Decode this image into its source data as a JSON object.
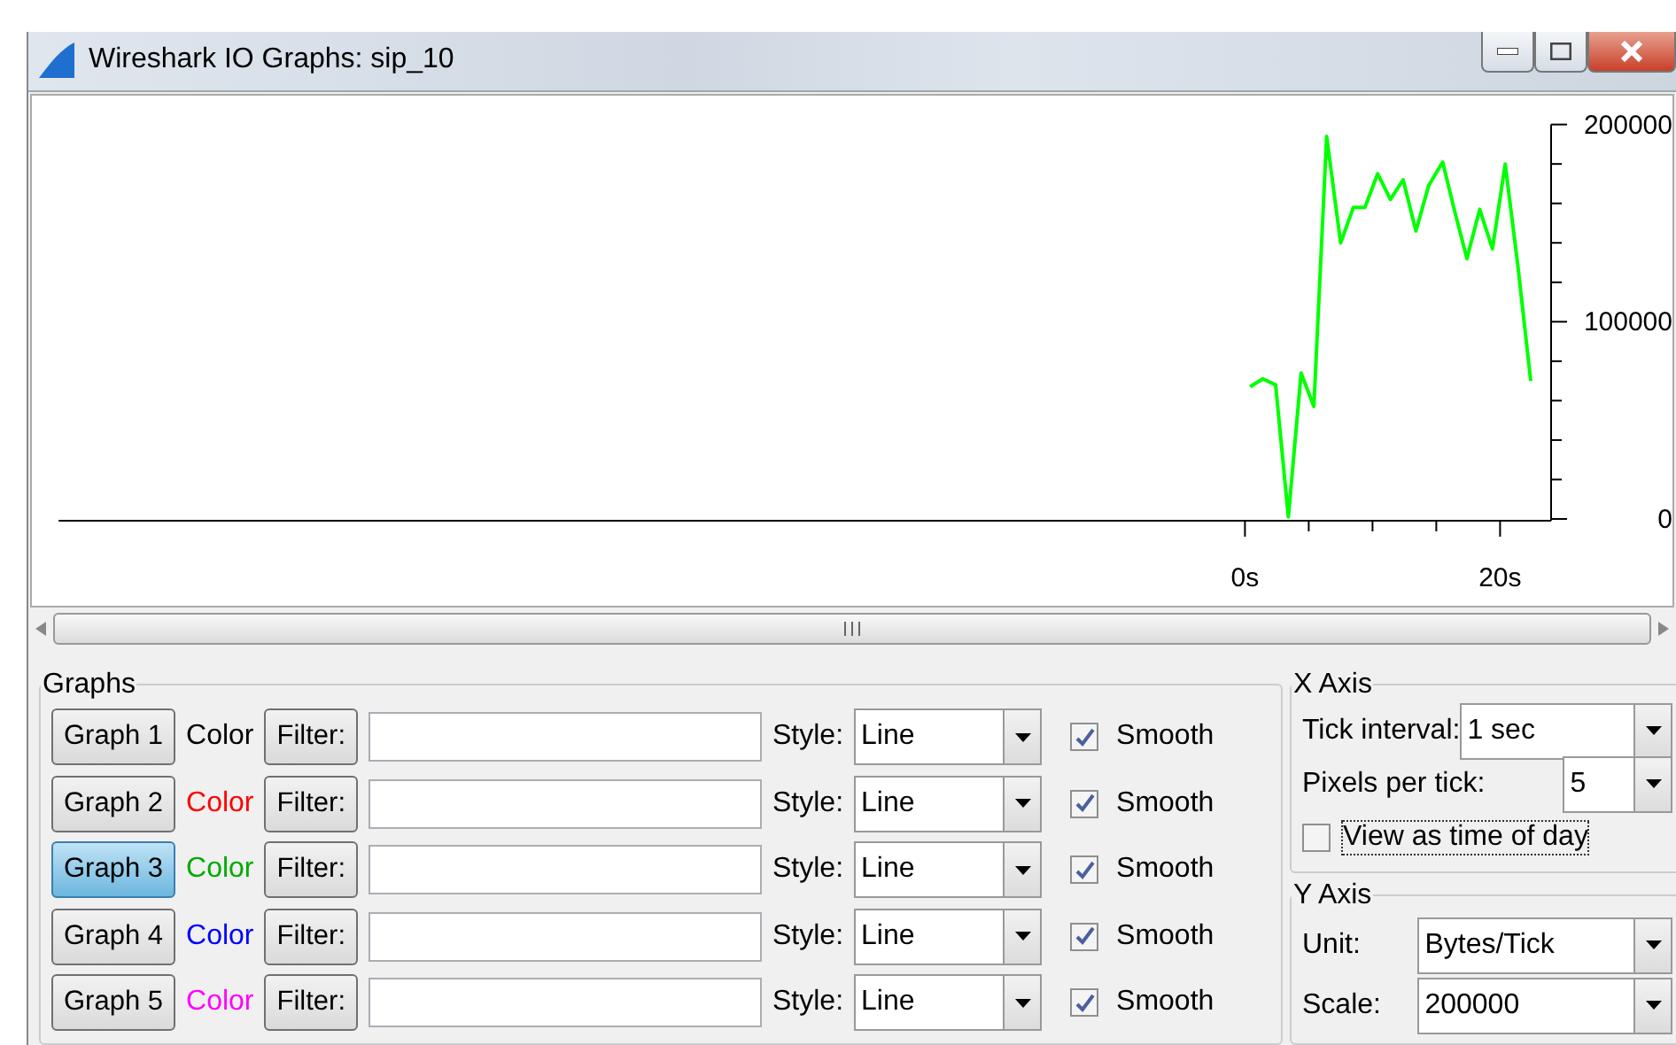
{
  "window": {
    "title": "Wireshark IO Graphs: sip_10"
  },
  "plot": {
    "chart_data": {
      "type": "line",
      "xlim": [
        -93,
        24
      ],
      "ylim": [
        0,
        200000
      ],
      "xticks": [
        {
          "value": 0,
          "label": "0s"
        },
        {
          "value": 20,
          "label": "20s"
        }
      ],
      "yticks": [
        0,
        100000,
        200000
      ],
      "x": [
        0.4,
        1.4,
        2.4,
        3.4,
        4.4,
        5.4,
        6.4,
        7.5,
        8.5,
        9.4,
        10.4,
        11.4,
        12.4,
        13.4,
        14.4,
        15.5,
        16.4,
        17.4,
        18.4,
        19.4,
        20.4,
        21.4,
        22.4
      ],
      "series": [
        {
          "color": "#00ff00",
          "values": [
            67000,
            71000,
            68000,
            1000,
            74000,
            57000,
            194000,
            140000,
            158000,
            158000,
            175000,
            162000,
            172000,
            146000,
            169000,
            181000,
            157000,
            132000,
            157000,
            137000,
            180000,
            128000,
            70000
          ]
        }
      ]
    }
  },
  "graphs_group": {
    "title": "Graphs",
    "rows": [
      {
        "button": "Graph 1",
        "selected": false,
        "color_label": "Color",
        "color": "#000000",
        "filter_button": "Filter:",
        "style_label": "Style:",
        "style": "Line",
        "smooth_label": "Smooth",
        "smooth": true
      },
      {
        "button": "Graph 2",
        "selected": false,
        "color_label": "Color",
        "color": "#ff0000",
        "filter_button": "Filter:",
        "style_label": "Style:",
        "style": "Line",
        "smooth_label": "Smooth",
        "smooth": true
      },
      {
        "button": "Graph 3",
        "selected": true,
        "color_label": "Color",
        "color": "#00aa00",
        "filter_button": "Filter:",
        "style_label": "Style:",
        "style": "Line",
        "smooth_label": "Smooth",
        "smooth": true
      },
      {
        "button": "Graph 4",
        "selected": false,
        "color_label": "Color",
        "color": "#0000ff",
        "filter_button": "Filter:",
        "style_label": "Style:",
        "style": "Line",
        "smooth_label": "Smooth",
        "smooth": true
      },
      {
        "button": "Graph 5",
        "selected": false,
        "color_label": "Color",
        "color": "#ff00ff",
        "filter_button": "Filter:",
        "style_label": "Style:",
        "style": "Line",
        "smooth_label": "Smooth",
        "smooth": true
      }
    ]
  },
  "x_axis": {
    "title": "X Axis",
    "tick_interval_label": "Tick interval:",
    "tick_interval": "1 sec",
    "pixels_per_tick_label": "Pixels per tick:",
    "pixels_per_tick": "5",
    "time_of_day_label": "View as time of day",
    "time_of_day": false
  },
  "y_axis": {
    "title": "Y Axis",
    "unit_label": "Unit:",
    "unit": "Bytes/Tick",
    "scale_label": "Scale:",
    "scale": "200000"
  }
}
